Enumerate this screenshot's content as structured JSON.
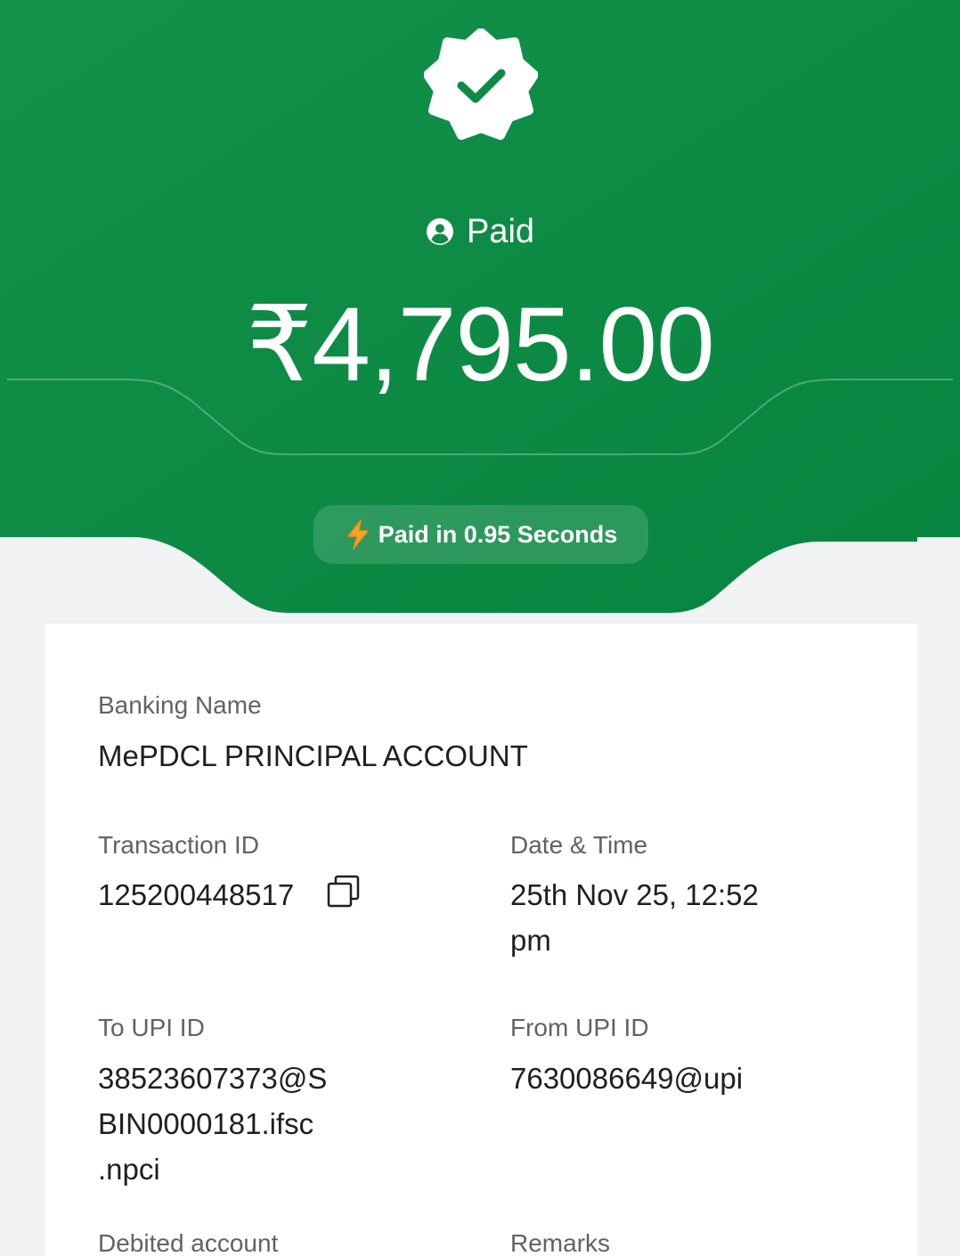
{
  "colors": {
    "header_green": "#0f8a45",
    "label_gray": "#5f6368",
    "value_black": "#1f1f1f"
  },
  "header": {
    "badge_icon": "verified-check-badge-icon",
    "status_icon": "user-circle-icon",
    "status_label": "Paid",
    "amount": "₹4,795.00",
    "speed_icon": "lightning-bolt-icon",
    "speed_label": "Paid in 0.95 Seconds"
  },
  "details": {
    "banking_name": {
      "label": "Banking Name",
      "value": "MePDCL PRINCIPAL ACCOUNT"
    },
    "transaction_id": {
      "label": "Transaction ID",
      "value": "125200448517",
      "action_icon": "copy-icon"
    },
    "date_time": {
      "label": "Date & Time",
      "value_line1": "25th Nov 25, 12:52",
      "value_line2": "pm"
    },
    "to_upi": {
      "label": "To UPI ID",
      "value_line1": "38523607373@S",
      "value_line2": "BIN0000181.ifsc",
      "value_line3": ".npci"
    },
    "from_upi": {
      "label": "From UPI ID",
      "value": "7630086649@upi"
    },
    "debited_account": {
      "label": "Debited account"
    },
    "remarks": {
      "label": "Remarks"
    }
  }
}
